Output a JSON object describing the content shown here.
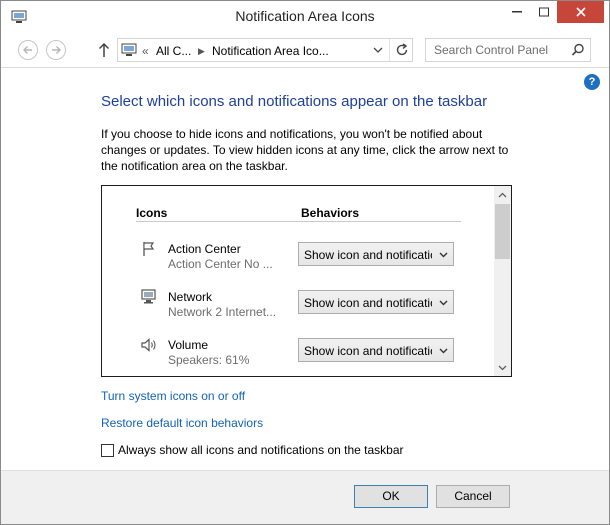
{
  "window": {
    "title": "Notification Area Icons"
  },
  "address_bar": {
    "overflow": "«",
    "crumb_root": "All C...",
    "crumb_current": "Notification Area Ico..."
  },
  "search": {
    "placeholder": "Search Control Panel"
  },
  "main": {
    "heading": "Select which icons and notifications appear on the taskbar",
    "description": "If you choose to hide icons and notifications, you won't be notified about changes or updates. To view hidden icons at any time, click the arrow next to the notification area on the taskbar.",
    "columns": {
      "icons": "Icons",
      "behaviors": "Behaviors"
    },
    "rows": [
      {
        "name": "Action Center",
        "sub": "Action Center  No ...",
        "behavior": "Show icon and notifications",
        "icon": "flag-icon"
      },
      {
        "name": "Network",
        "sub": "Network  2 Internet...",
        "behavior": "Show icon and notifications",
        "icon": "network-icon"
      },
      {
        "name": "Volume",
        "sub": "Speakers: 61%",
        "behavior": "Show icon and notifications",
        "icon": "speaker-icon"
      }
    ],
    "link_system_icons": "Turn system icons on or off",
    "link_restore": "Restore default icon behaviors",
    "always_show_label": "Always show all icons and notifications on the taskbar",
    "always_show_checked": false
  },
  "footer": {
    "ok": "OK",
    "cancel": "Cancel"
  },
  "colors": {
    "heading": "#1e3f9b",
    "link": "#1262b8",
    "close": "#c7463a",
    "help": "#1f6fc0"
  }
}
